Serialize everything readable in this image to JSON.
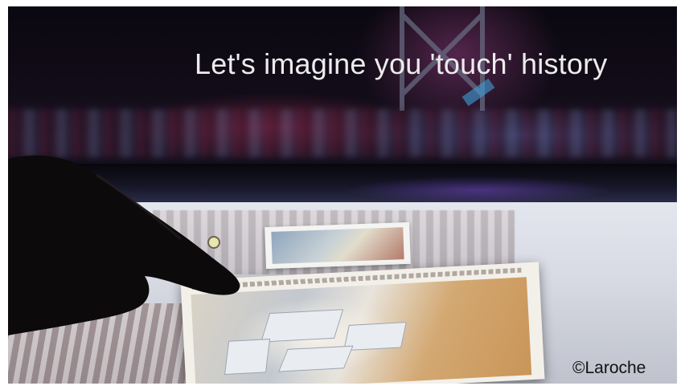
{
  "image": {
    "caption": "Let's imagine you 'touch' history",
    "credit": "©Laroche"
  },
  "colors": {
    "caption_text": "#ececec",
    "credit_text": "#111111",
    "background_dark": "#0b0a10",
    "table_surface": "#dcdfe7"
  }
}
